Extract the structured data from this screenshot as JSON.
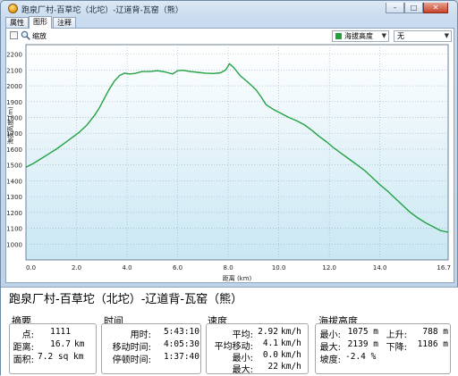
{
  "window": {
    "title": "跑泉厂村-百草坨（北坨）-辽道背-瓦窑（熊）",
    "buttons": {
      "minimize": "–",
      "maximize": "□",
      "close": "✕"
    }
  },
  "tabs": [
    {
      "label": "属性",
      "active": false
    },
    {
      "label": "图形",
      "active": true
    },
    {
      "label": "注释",
      "active": false
    }
  ],
  "toolbar": {
    "zoom_label": "缩放",
    "series_select": "海拔高度",
    "secondary_select": "无"
  },
  "colors": {
    "line": "#22a242",
    "plot_bg_top": "#ffffff",
    "plot_bg_bottom": "#cfe9f4",
    "grid": "#9ab2c6"
  },
  "chart_data": {
    "type": "line",
    "xlabel": "距离 (km)",
    "ylabel": "海拔高度 (m)",
    "xlim": [
      0,
      16.7
    ],
    "ylim": [
      900,
      2260
    ],
    "x_ticks": [
      "0.0",
      "2.0",
      "4.0",
      "6.0",
      "8.0",
      "10.0",
      "12.0",
      "14.0",
      "16.7"
    ],
    "x_tick_values": [
      0,
      2,
      4,
      6,
      8,
      10,
      12,
      14,
      16.7
    ],
    "y_ticks": [
      "1000",
      "1100",
      "1200",
      "1300",
      "1400",
      "1500",
      "1600",
      "1700",
      "1800",
      "1900",
      "2000",
      "2100",
      "2200"
    ],
    "y_tick_values": [
      1000,
      1100,
      1200,
      1300,
      1400,
      1500,
      1600,
      1700,
      1800,
      1900,
      2000,
      2100,
      2200
    ],
    "grid": true,
    "series": [
      {
        "x": [
          0,
          0.3,
          0.6,
          0.9,
          1.2,
          1.5,
          1.8,
          2.1,
          2.4,
          2.7,
          2.9,
          3.1,
          3.3,
          3.5,
          3.7,
          3.9,
          4.1,
          4.3,
          4.6,
          4.9,
          5.2,
          5.5,
          5.8,
          6.0,
          6.2,
          6.5,
          6.8,
          7.1,
          7.4,
          7.7,
          7.9,
          8.05,
          8.2,
          8.5,
          8.8,
          9.1,
          9.3,
          9.5,
          9.8,
          10.1,
          10.4,
          10.7,
          11.0,
          11.3,
          11.6,
          11.9,
          12.2,
          12.5,
          12.8,
          13.1,
          13.4,
          13.7,
          14.0,
          14.3,
          14.6,
          14.9,
          15.2,
          15.5,
          15.8,
          16.1,
          16.4,
          16.7
        ],
        "y": [
          1485,
          1510,
          1540,
          1570,
          1600,
          1635,
          1670,
          1705,
          1750,
          1810,
          1860,
          1920,
          1980,
          2030,
          2065,
          2080,
          2075,
          2078,
          2090,
          2090,
          2095,
          2088,
          2075,
          2095,
          2098,
          2090,
          2085,
          2080,
          2078,
          2082,
          2100,
          2139,
          2118,
          2060,
          2020,
          1975,
          1930,
          1880,
          1850,
          1825,
          1800,
          1780,
          1755,
          1720,
          1680,
          1645,
          1605,
          1570,
          1535,
          1500,
          1465,
          1420,
          1375,
          1335,
          1290,
          1245,
          1200,
          1165,
          1135,
          1110,
          1085,
          1075
        ]
      }
    ]
  },
  "summary": {
    "route_name": "跑泉厂村-百草坨（北坨）-辽道背-瓦窑（熊）",
    "sections": {
      "overview": "摘要",
      "time": "时间",
      "speed": "速度",
      "altitude": "海拔高度"
    },
    "overview": {
      "points_label": "点:",
      "points_value": "1111",
      "distance_label": "距离:",
      "distance_value": "16.7",
      "distance_unit": "km",
      "area_label": "面积:",
      "area_value": "7.2 sq km"
    },
    "time": {
      "elapsed_label": "用时:",
      "elapsed_value": "5:43:10",
      "moving_label": "移动时间:",
      "moving_value": "4:05:30",
      "stopped_label": "停顿时间:",
      "stopped_value": "1:37:40"
    },
    "speed": {
      "avg_label": "平均:",
      "avg_value": "2.92",
      "avg_unit": "km/h",
      "avg_moving_label": "平均移动:",
      "avg_moving_value": "4.1",
      "avg_moving_unit": "km/h",
      "min_label": "最小:",
      "min_value": "0.0",
      "min_unit": "km/h",
      "max_label": "最大:",
      "max_value": "22",
      "max_unit": "km/h"
    },
    "altitude": {
      "min_label": "最小:",
      "min_value": "1075 m",
      "max_label": "最大:",
      "max_value": "2139 m",
      "grade_label": "坡度:",
      "grade_value": "-2.4 %",
      "ascent_label": "上升:",
      "ascent_value": "788 m",
      "descent_label": "下降:",
      "descent_value": "1186 m"
    }
  }
}
